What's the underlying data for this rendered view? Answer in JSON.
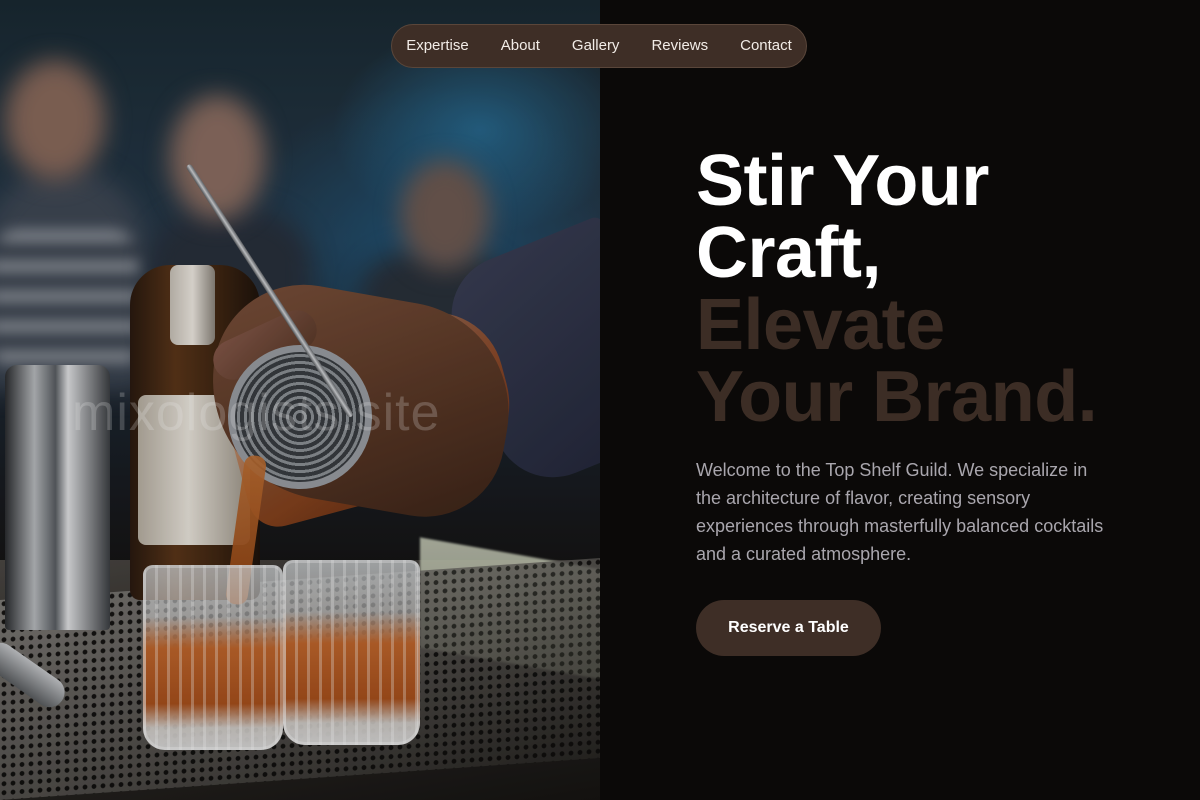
{
  "nav": {
    "items": [
      {
        "label": "Expertise"
      },
      {
        "label": "About"
      },
      {
        "label": "Gallery"
      },
      {
        "label": "Reviews"
      },
      {
        "label": "Contact"
      }
    ]
  },
  "hero": {
    "title_lines": [
      "Stir Your",
      "Craft,",
      "Elevate",
      "Your Brand."
    ],
    "description": "Welcome to the Top Shelf Guild. We specialize in the architecture of flavor, creating sensory experiences through masterfully balanced cocktails and a curated atmosphere.",
    "cta_label": "Reserve a Table"
  },
  "photo": {
    "watermark_text": "mixologists.site"
  },
  "colors": {
    "background": "#0b0908",
    "accent": "#3e2e26",
    "title_light": "#ffffff",
    "title_muted": "#3c2d25",
    "body_text": "#a9a6ad"
  }
}
